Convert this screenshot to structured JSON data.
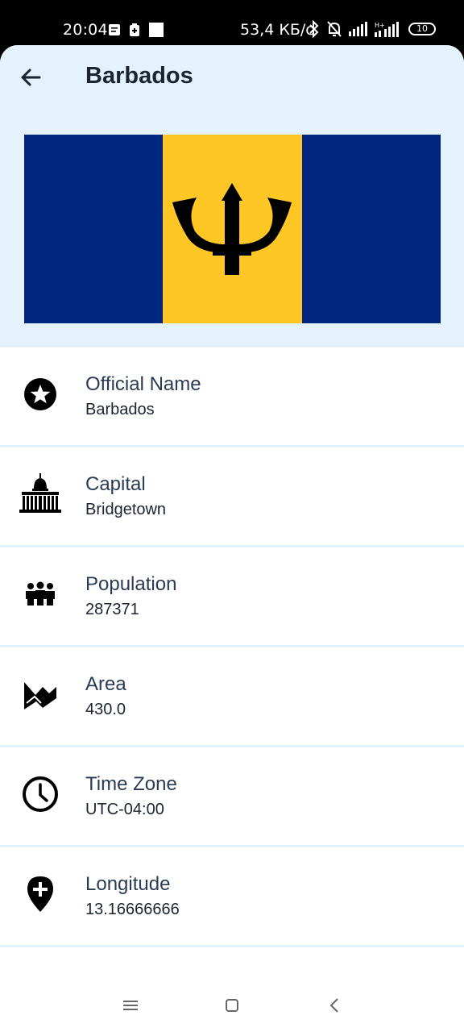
{
  "status_bar": {
    "time": "20:04",
    "speed": "53,4 КБ/с",
    "battery": "10",
    "network_label": "H+"
  },
  "app_bar": {
    "title": "Barbados",
    "back_icon": "arrow-left-icon"
  },
  "flag": {
    "country": "Barbados",
    "colors": {
      "blue": "#00267f",
      "gold": "#ffc726",
      "trident": "#000000"
    }
  },
  "details": [
    {
      "icon": "star-circle-icon",
      "label": "Official Name",
      "value": "Barbados"
    },
    {
      "icon": "capitol-building-icon",
      "label": "Capital",
      "value": "Bridgetown"
    },
    {
      "icon": "people-group-icon",
      "label": "Population",
      "value": "287371"
    },
    {
      "icon": "terrain-icon",
      "label": "Area",
      "value": "430.0"
    },
    {
      "icon": "clock-icon",
      "label": "Time Zone",
      "value": "UTC-04:00"
    },
    {
      "icon": "map-pin-plus-icon",
      "label": "Longitude",
      "value": "13.16666666"
    }
  ],
  "colors": {
    "app_bar_bg": "#e3f2fb",
    "label_text": "#2a3b55",
    "value_text": "#1b2430"
  }
}
